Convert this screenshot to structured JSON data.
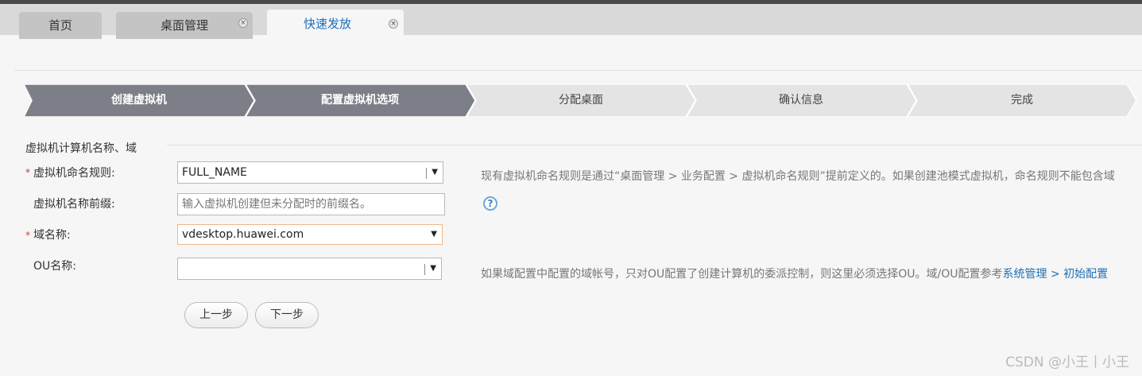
{
  "tabs": [
    {
      "label": "首页",
      "active": false,
      "closable": false
    },
    {
      "label": "桌面管理",
      "active": false,
      "closable": true
    },
    {
      "label": "快速发放",
      "active": true,
      "closable": true
    }
  ],
  "steps": [
    {
      "label": "创建虚拟机",
      "state": "done"
    },
    {
      "label": "配置虚拟机选项",
      "state": "done"
    },
    {
      "label": "分配桌面",
      "state": "todo"
    },
    {
      "label": "确认信息",
      "state": "todo"
    },
    {
      "label": "完成",
      "state": "todo"
    }
  ],
  "section_title": "虚拟机计算机名称、域",
  "form": {
    "naming_rule": {
      "required_mark": "*",
      "label": "虚拟机命名规则:",
      "value": "FULL_NAME"
    },
    "name_prefix": {
      "label": "虚拟机名称前缀:",
      "placeholder": "输入虚拟机创建但未分配时的前缀名。"
    },
    "domain": {
      "required_mark": "*",
      "label": "域名称:",
      "value": "vdesktop.huawei.com"
    },
    "ou": {
      "label": "OU名称:",
      "value": ""
    }
  },
  "hints": {
    "naming_rule": "现有虚拟机命名规则是通过“桌面管理 > 业务配置 > 虚拟机命名规则”提前定义的。如果创建池模式虚拟机，命名规则不能包含域",
    "ou_prefix": "如果域配置中配置的域帐号，只对OU配置了创建计算机的委派控制，则这里必须选择OU。域/OU配置参考",
    "ou_link": "系统管理 > 初始配置"
  },
  "icons": {
    "help": "?",
    "close": "×",
    "dropdown": "▼"
  },
  "buttons": {
    "prev": "上一步",
    "next": "下一步"
  },
  "watermark": "CSDN @小王丨小王",
  "colors": {
    "step_done": "#7c7f87",
    "step_todo": "#e4e4e4",
    "link": "#1e6fb5",
    "required": "#d33"
  }
}
